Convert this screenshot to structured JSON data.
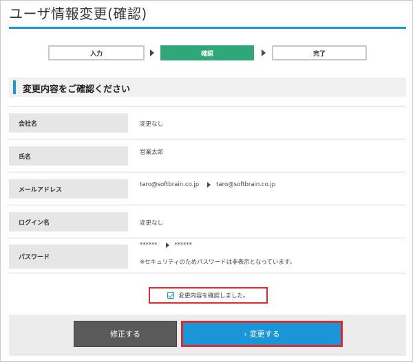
{
  "page": {
    "title": "ユーザ情報変更(確認)"
  },
  "steps": [
    {
      "label": "入力",
      "active": false
    },
    {
      "label": "確認",
      "active": true
    },
    {
      "label": "完了",
      "active": false
    }
  ],
  "section": {
    "title": "変更内容をご確認ください"
  },
  "fields": {
    "company": {
      "label": "会社名",
      "value": "変更なし"
    },
    "name": {
      "label": "氏名",
      "value": "営業太郎"
    },
    "email": {
      "label": "メールアドレス",
      "old_value": "taro@softbrain.co.jp",
      "new_value": "taro@softbrain.co.jp"
    },
    "login": {
      "label": "ログイン名",
      "value": "変更なし"
    },
    "password": {
      "label": "パスワード",
      "old_value": "******",
      "new_value": "******",
      "note": "※セキュリティのためパスワードは非表示となっています。"
    }
  },
  "confirm": {
    "label": "変更内容を確認しました。",
    "checked": true
  },
  "buttons": {
    "fix": "修正する",
    "submit": "› 変更する"
  },
  "colors": {
    "accent": "#1a96d8",
    "step_active": "#2fa77a",
    "highlight": "#e0282e"
  }
}
